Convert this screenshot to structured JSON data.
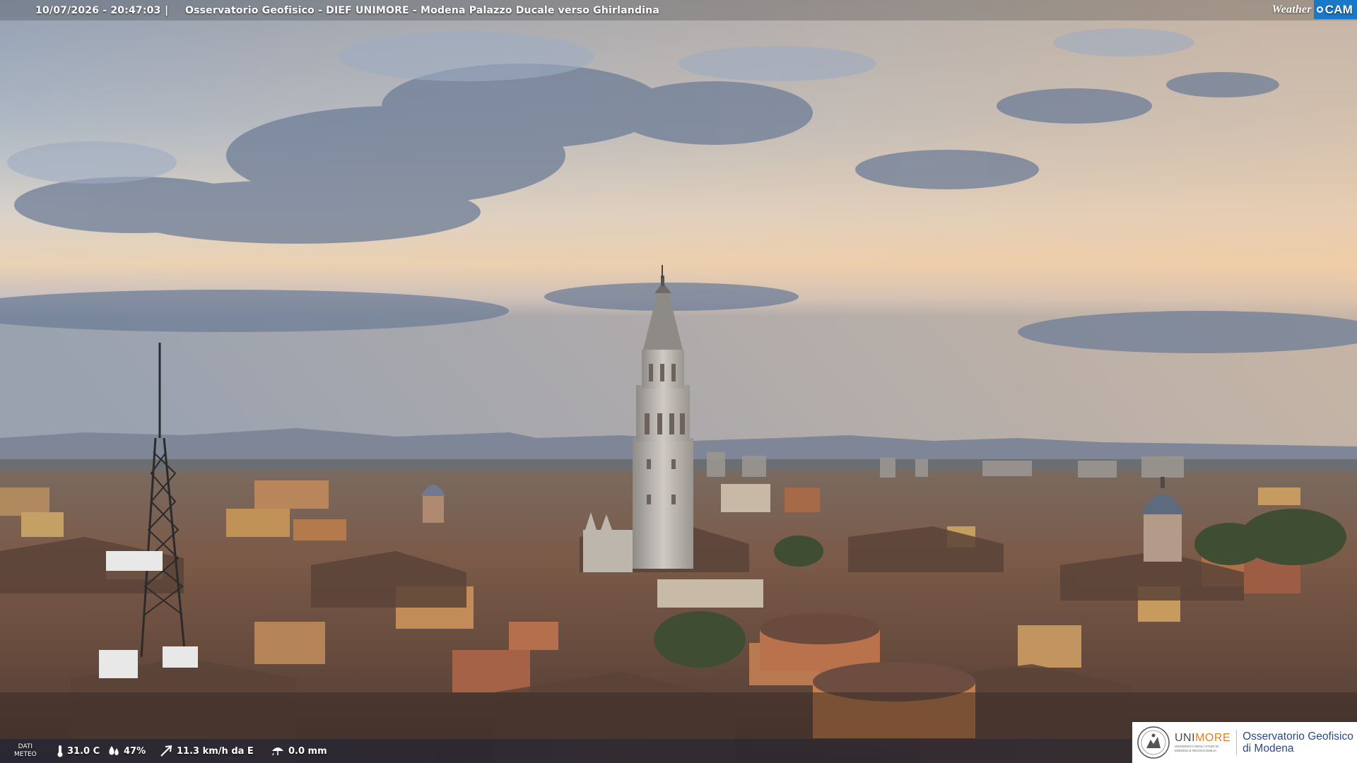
{
  "topbar": {
    "timestamp": "10/07/2026 - 20:47:03",
    "separator": "|",
    "camera_title": "Osservatorio Geofisico - DIEF UNIMORE - Modena Palazzo Ducale verso Ghirlandina",
    "logo_weather": "Weather",
    "logo_cam": "CAM"
  },
  "weather": {
    "label_line1": "DATI",
    "label_line2": "METEO",
    "temperature": "31.0 C",
    "humidity": "47%",
    "wind": "11.3 km/h da E",
    "rain": "0.0 mm"
  },
  "logo": {
    "university_uni": "UNI",
    "university_more": "MORE",
    "university_sub_1": "UNIVERSITÀ DEGLI STUDI DI",
    "university_sub_2": "MODENA E REGGIO EMILIA",
    "observatory_line1": "Osservatorio Geofisico",
    "observatory_line2": "di Modena"
  },
  "colors": {
    "sky_top": "#8d9fb8",
    "sky_horizon": "#e9c9a6",
    "roofs": "#6b4a3a",
    "brand_blue": "#1a78c8",
    "unimore_orange": "#e0801a"
  }
}
